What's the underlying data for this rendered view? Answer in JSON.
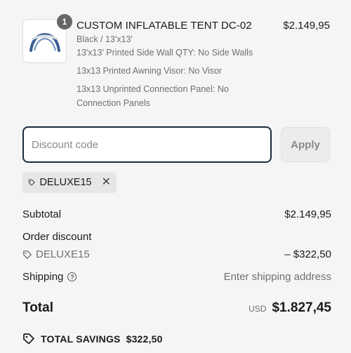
{
  "product": {
    "image_alt": "inflatable tent",
    "quantity": "1",
    "title": "CUSTOM INFLATABLE TENT DC-02",
    "price": "$2.149,95",
    "variant": "Black / 13'x13'",
    "properties": [
      "13'x13' Printed Side Wall QTY: No Side Walls",
      "13x13 Printed Awning Visor: No Visor",
      "13x13 Unprinted Connection Panel: No",
      "Connection Panels"
    ]
  },
  "discount": {
    "placeholder": "Discount code",
    "value": "",
    "apply_label": "Apply",
    "applied_code": "DELUXE15"
  },
  "summary": {
    "subtotal_label": "Subtotal",
    "subtotal_value": "$2.149,95",
    "order_discount_label": "Order discount",
    "order_discount_code": "DELUXE15",
    "order_discount_value": "– $322,50",
    "shipping_label": "Shipping",
    "shipping_value": "Enter shipping address",
    "total_label": "Total",
    "currency": "USD",
    "total_value": "$1.827,45",
    "savings_label": "TOTAL SAVINGS",
    "savings_value": "$322,50"
  },
  "colors": {
    "input_border": "#1c2b3a",
    "muted_text": "#707070",
    "background": "#f5f5f5"
  }
}
